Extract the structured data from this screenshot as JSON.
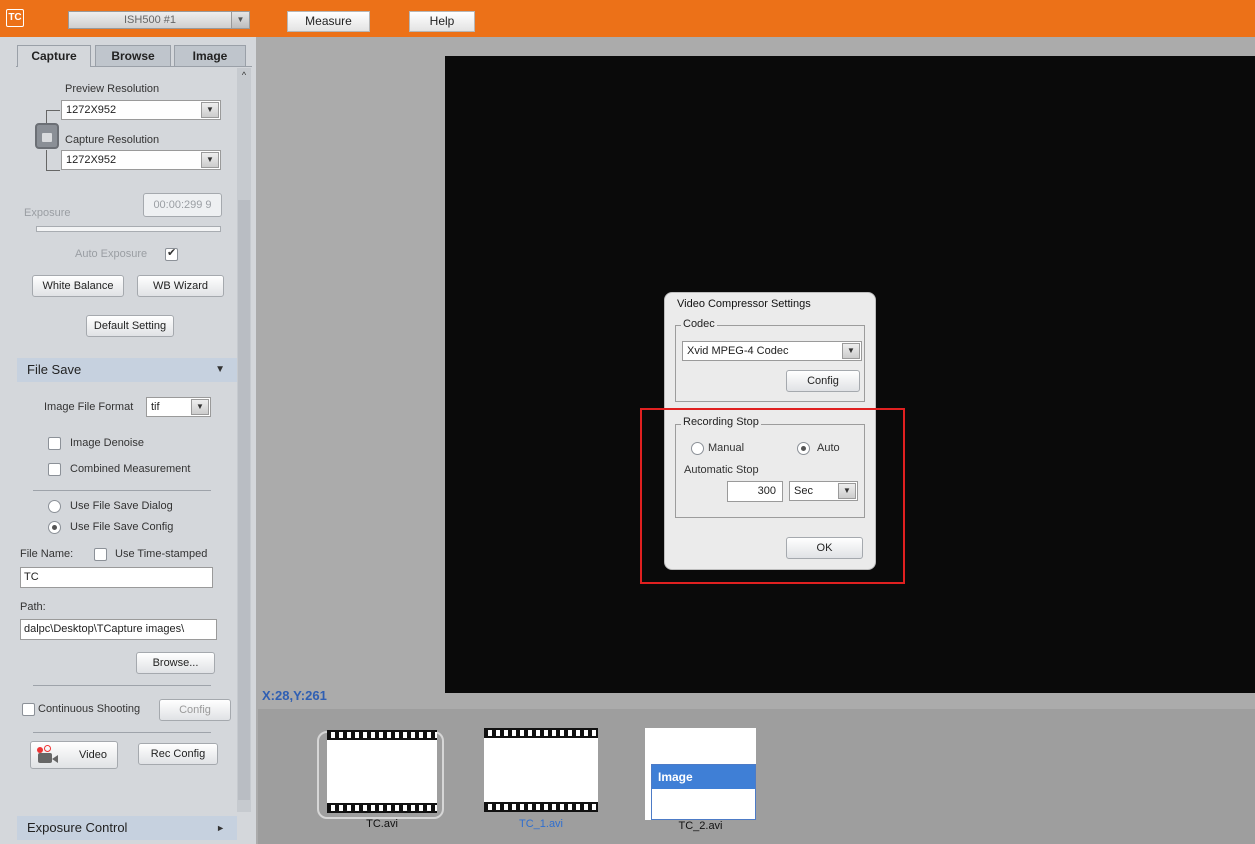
{
  "topbar": {
    "logo": "TC",
    "camera": "ISH500 #1",
    "menus": [
      "Measure",
      "Help"
    ],
    "color": "#ec7118"
  },
  "tabs": [
    "Capture",
    "Browse",
    "Image"
  ],
  "capture": {
    "preview_resolution_label": "Preview Resolution",
    "preview_resolution_value": "1272X952",
    "capture_resolution_label": "Capture Resolution",
    "capture_resolution_value": "1272X952",
    "exposure_label": "Exposure",
    "exposure_value": "00:00:299 9",
    "auto_exposure_label": "Auto Exposure",
    "white_balance": "White Balance",
    "wb_wizard": "WB Wizard",
    "default_setting": "Default Setting"
  },
  "file_save": {
    "title": "File Save",
    "image_format_label": "Image File Format",
    "image_format_value": "tif",
    "image_denoise": "Image Denoise",
    "combined_measurement": "Combined Measurement",
    "use_dialog": "Use File Save Dialog",
    "use_config": "Use File Save Config",
    "file_name_label": "File Name:",
    "use_timestamped": "Use Time-stamped",
    "file_name_value": "TC",
    "path_label": "Path:",
    "path_value": "dalpc\\Desktop\\TCapture images\\",
    "browse": "Browse...",
    "continuous_shooting": "Continuous Shooting",
    "config": "Config",
    "video": "Video",
    "rec_config": "Rec Config"
  },
  "exposure_control": "Exposure Control",
  "coords": "X:28,Y:261",
  "gallery": [
    {
      "name": "TC.avi",
      "color": "#111111"
    },
    {
      "name": "TC_1.avi",
      "color": "#2f6fd0"
    },
    {
      "name": "TC_2.avi",
      "color": "#111111",
      "inner_label": "Image"
    }
  ],
  "dialog": {
    "title": "Video Compressor Settings",
    "codec_group": "Codec",
    "codec_value": "Xvid MPEG-4 Codec",
    "config": "Config",
    "recording_group": "Recording Stop",
    "manual": "Manual",
    "auto": "Auto",
    "automatic_stop": "Automatic Stop",
    "stop_value": "300",
    "unit": "Sec",
    "ok": "OK",
    "highlight_color": "#e02020"
  }
}
